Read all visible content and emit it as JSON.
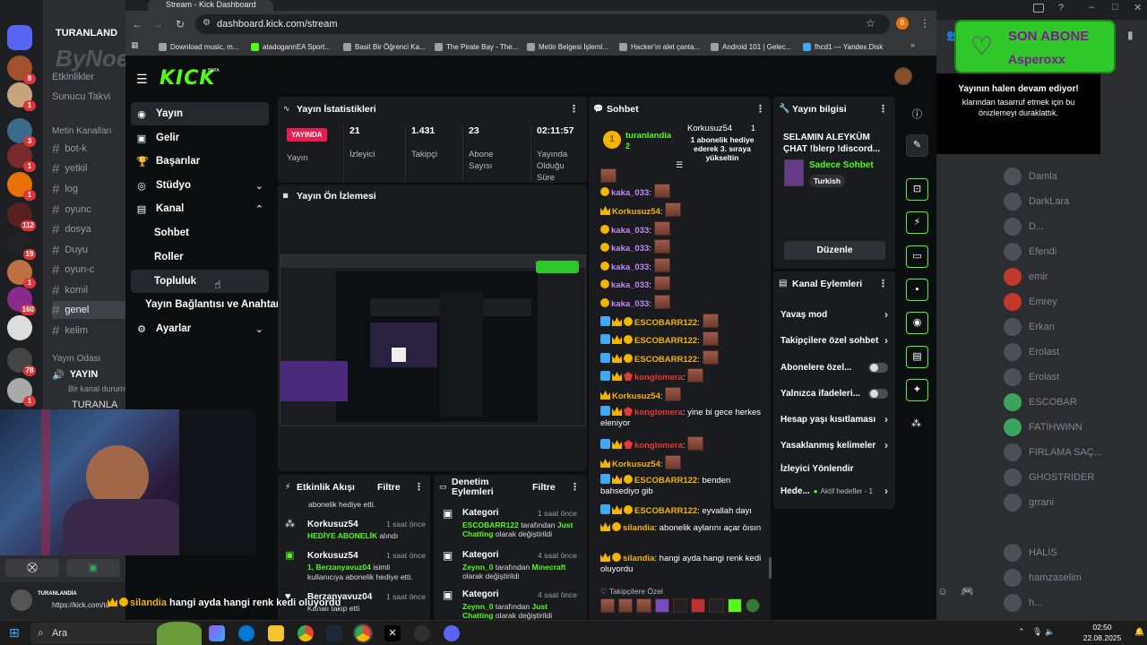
{
  "discord": {
    "server_name": "TURANLAND",
    "watermark": "ByNoeJe",
    "top_items": [
      "Etkinlikler",
      "Sunucu Takvi"
    ],
    "category_text": "Metin Kanalları",
    "channels": [
      "bot-k",
      "yetkil",
      "log",
      "oyunc",
      "dosya",
      "Duyu",
      "oyun-c",
      "komil",
      "genel",
      "kelim"
    ],
    "voice_category": "Yayın Odası",
    "voice_channel": "YAYIN",
    "voice_sub": "Bir kanal durumu",
    "voice_user": "TURANLA",
    "guild_badges": [
      "8",
      "1",
      "3",
      "1",
      "1",
      "112",
      "19",
      "1",
      "160",
      "78",
      "1"
    ],
    "user_name": "TURANLANDİA",
    "user_status": "https://kick.com/tu",
    "members": [
      "Damla",
      "DarkLara",
      "D...",
      "Efendi",
      "emir",
      "Emrey",
      "Erkan",
      "Erolast",
      "Erolast",
      "ESCOBAR",
      "FATİHWINN",
      "FIRLAMA SAÇ...",
      "GHOSTRİDER",
      "grrani",
      "HALİS",
      "hamzaselim",
      "h..."
    ]
  },
  "browser": {
    "tab_title": "Stream - Kick Dashboard",
    "url": "dashboard.kick.com/stream",
    "profile_initial": "B",
    "bookmarks": [
      "Download music, m...",
      "atadogannEA Sport...",
      "Basit Bir Öğrenci Ka...",
      "The Pirate Bay - The...",
      "Metin Belgesi İşleml...",
      "Hacker'ın alet çanta...",
      "Android 101 | Gelec...",
      "fhcd1 — Yandex.Disk"
    ]
  },
  "kick": {
    "logo": "KICK",
    "beta": "BETA",
    "sidebar": {
      "yayin": "Yayın",
      "gelir": "Gelir",
      "basarilar": "Başarılar",
      "studyo": "Stüdyo",
      "kanal": "Kanal",
      "sohbet": "Sohbet",
      "roller": "Roller",
      "topluluk": "Topluluk",
      "baglanti": "Yayın Bağlantısı ve Anahtarı",
      "ayarlar": "Ayarlar"
    },
    "stats": {
      "title": "Yayın İstatistikleri",
      "live_badge": "YAYINDA",
      "live_label": "Yayın",
      "viewers": "21",
      "viewers_label": "İzleyici",
      "followers": "1.431",
      "followers_label": "Takipçi",
      "subs": "23",
      "subs_label": "Abone Sayısı",
      "uptime": "02:11:57",
      "uptime_label": "Yayında Olduğu Süre"
    },
    "preview_title": "Yayın Ön İzlemesi",
    "chat": {
      "title": "Sohbet",
      "pinned_user": "turanlandia",
      "pinned_count": "2",
      "gift_user": "Korkusuz54",
      "gift_count": "1",
      "gift_text": "1 abonelik hediye ederek 3. sıraya yükseltin",
      "lines": [
        {
          "name": "kaka_033",
          "msg": ""
        },
        {
          "name": "Korkusuz54",
          "msg": ""
        },
        {
          "name": "kaka_033",
          "msg": ""
        },
        {
          "name": "kaka_033",
          "msg": ""
        },
        {
          "name": "kaka_033",
          "msg": ""
        },
        {
          "name": "kaka_033",
          "msg": ""
        },
        {
          "name": "kaka_033",
          "msg": ""
        },
        {
          "name": "ESCOBARR122",
          "msg": ""
        },
        {
          "name": "ESCOBARR122",
          "msg": ""
        },
        {
          "name": "ESCOBARR122",
          "msg": ""
        },
        {
          "name": "konglomera",
          "msg": ""
        },
        {
          "name": "Korkusuz54",
          "msg": ""
        },
        {
          "name": "konglomera",
          "msg": "yine bi gece herkes eleniyor"
        },
        {
          "name": "konglomera",
          "msg": ""
        },
        {
          "name": "Korkusuz54",
          "msg": ""
        },
        {
          "name": "ESCOBARR122",
          "msg": "benden bahsediyo gib"
        },
        {
          "name": "ESCOBARR122",
          "msg": "eyvallah dayı"
        },
        {
          "name": "silandia",
          "msg": "abonelik aylarını açar öısın"
        },
        {
          "name": "silandia",
          "msg": "hangi ayda hangi renk kedi oluyordu"
        }
      ],
      "followers_only": "Takipçilere Özel"
    },
    "info": {
      "title": "Yayın bilgisi",
      "stream_title": "SELAMIN ALEYKÜM ÇHAT !blerp !discord...",
      "category": "Sadece Sohbet",
      "language": "Turkish",
      "edit": "Düzenle"
    },
    "actions": {
      "title": "Kanal Eylemleri",
      "slow": "Yavaş mod",
      "followers": "Takipçilere özel sohbet",
      "subs": "Abonelere özel...",
      "emotes": "Yalnızca ifadeleri...",
      "age": "Hesap yaşı kısıtlaması",
      "banned": "Yasaklanmış kelimeler",
      "redirect": "İzleyici Yönlendir",
      "goals": "Hede...",
      "goals_sub": "Aktif hedefler - 1"
    },
    "activity": {
      "title": "Etkinlik Akışı",
      "filter": "Filtre",
      "top_fragment": "abonelik hediye etti.",
      "items": [
        {
          "name": "Korkusuz54",
          "time": "1 saat önce",
          "hl": "HEDİYE ABONELİK",
          "rest": " alındı"
        },
        {
          "name": "Korkusuz54",
          "time": "1 saat önce",
          "hl": "1, Berzanyavuz04",
          "rest": " isimli kullanıcıya abonelik hediye etti."
        },
        {
          "name": "Berzanyavuz04",
          "time": "1 saat önce",
          "hl": "",
          "rest": "Kanalı takip etti"
        }
      ]
    },
    "moderation": {
      "title": "Denetim Eylemleri",
      "filter": "Filtre",
      "items": [
        {
          "t": "Kategori",
          "time": "1 saat önce",
          "user": "ESCOBARR122",
          "mid": " tarafından ",
          "cat": "Just Chatting",
          "end": " olarak değiştirildi"
        },
        {
          "t": "Kategori",
          "time": "4 saat önce",
          "user": "Zeynn_0",
          "mid": " tarafından ",
          "cat": "Minecraft",
          "end": " olarak değiştirildi"
        },
        {
          "t": "Kategori",
          "time": "4 saat önce",
          "user": "Zeynn_0",
          "mid": " tarafından ",
          "cat": "Just Chatting",
          "end": " olarak değiştirildi"
        }
      ]
    }
  },
  "overlay": {
    "son_abone_title": "SON ABONE",
    "son_abone_name": "Asperoxx",
    "live_notice": "Yayının halen devam ediyor!",
    "live_sub": "klarından tasarruf etmek için bu önizlemeyi duraklattık.",
    "chat_overlay_name": "silandia",
    "chat_overlay_msg": "hangi ayda hangi renk kedi oluyordu"
  },
  "taskbar": {
    "search": "Ara",
    "time": "02:50",
    "date": "22.08.2025"
  },
  "colors": {
    "kick_green": "#53fc18",
    "panel": "#191b1f",
    "badge_gold": "#f4b400"
  }
}
